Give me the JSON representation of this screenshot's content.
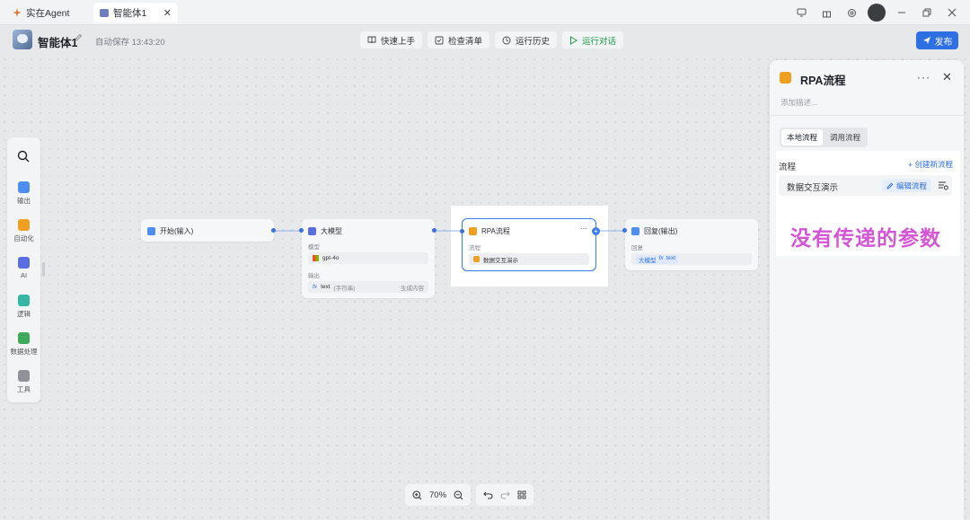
{
  "window": {
    "app_tab": "实在Agent",
    "doc_tab": "智能体1",
    "close_glyph": "✕"
  },
  "header": {
    "agent_name": "智能体1",
    "autosave": "自动保存 13:43:20",
    "toolbar": [
      {
        "icon": "book-icon",
        "label": "快速上手"
      },
      {
        "icon": "checklist-icon",
        "label": "检查清单"
      },
      {
        "icon": "history-icon",
        "label": "运行历史"
      },
      {
        "icon": "play-icon",
        "label": "运行对话"
      }
    ],
    "publish": "发布"
  },
  "rail": {
    "items": [
      {
        "label": "输出",
        "color": "#4d8ef0"
      },
      {
        "label": "自动化",
        "color": "#f0a020"
      },
      {
        "label": "AI",
        "color": "#5b6ee1"
      },
      {
        "label": "逻辑",
        "color": "#37b6a3"
      },
      {
        "label": "数据处理",
        "color": "#3eaa5c"
      },
      {
        "label": "工具",
        "color": "#8e9299"
      }
    ]
  },
  "nodes": {
    "start": {
      "title": "开始(输入)"
    },
    "llm": {
      "title": "大模型",
      "model_label": "模型",
      "model_value": "gpt-4o",
      "output_label": "输出",
      "output_var": "text",
      "output_type": "(字符串)",
      "output_desc": "生成内容",
      "fx": "fx"
    },
    "rpa": {
      "title": "RPA流程",
      "flow_label": "流程",
      "flow_value": "数据交互演示"
    },
    "reply": {
      "title": "回复(输出)",
      "reply_label": "回复",
      "tag_source": "大模型",
      "tag_var": "text",
      "fx": "fx"
    }
  },
  "zoom": {
    "level": "70%"
  },
  "panel": {
    "title": "RPA流程",
    "more": "···",
    "close": "✕",
    "description_placeholder": "添加描述...",
    "tabs": [
      {
        "label": "本地流程",
        "active": true
      },
      {
        "label": "调用流程",
        "active": false
      }
    ],
    "flow_label": "流程",
    "create_new": "+ 创建新流程",
    "flow_name": "数据交互演示",
    "edit_flow": "编辑流程",
    "annotation": "没有传递的参数"
  },
  "colors": {
    "accent": "#2f6fe4",
    "run_green": "#1f9b4a",
    "annotation_pink": "#d455d6",
    "rpa_orange": "#f0a020"
  }
}
